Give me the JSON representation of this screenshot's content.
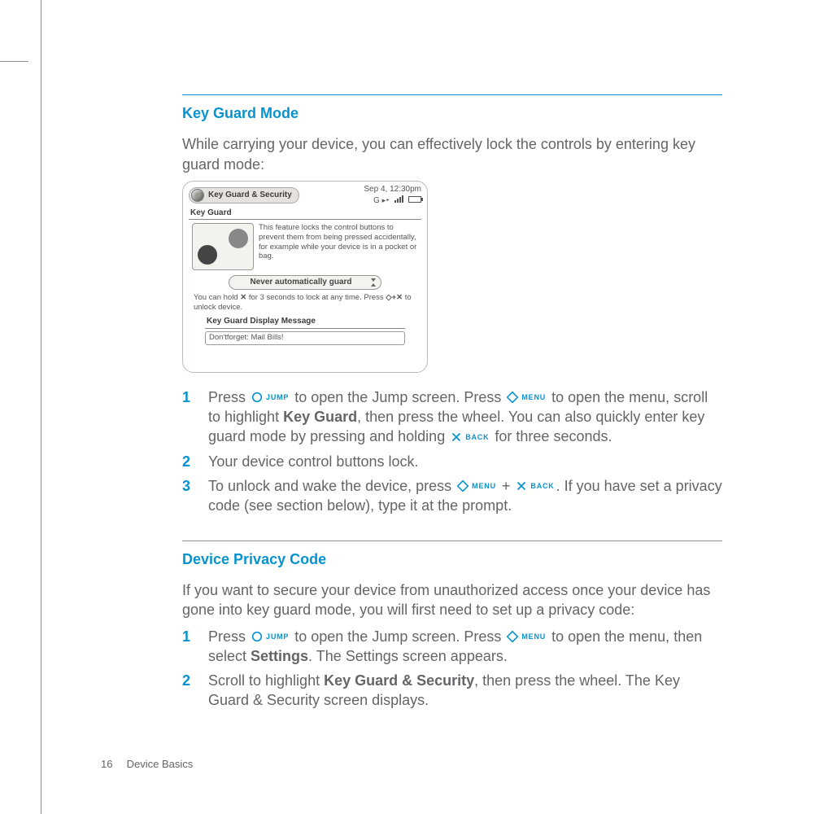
{
  "section1": {
    "heading": "Key Guard Mode",
    "intro": "While carrying your device, you can effectively lock the controls by entering key guard mode:",
    "steps": [
      {
        "num": "1",
        "parts": {
          "a": "Press ",
          "b": " to open the Jump screen. Press ",
          "c": " to open the menu, scroll to highlight ",
          "d": "Key Guard",
          "e": ", then press the wheel. You can also quickly enter key guard mode by pressing and holding ",
          "f": " for three seconds."
        }
      },
      {
        "num": "2",
        "text": "Your device control buttons lock."
      },
      {
        "num": "3",
        "parts": {
          "a": "To unlock and wake the device, press ",
          "b": " + ",
          "c": ". If you have set a privacy code (see section below), type it at the prompt."
        }
      }
    ]
  },
  "section2": {
    "heading": "Device Privacy Code",
    "intro": "If you want to secure your device from unauthorized access once your device has gone into key guard mode, you will first need to set up a privacy code:",
    "steps": [
      {
        "num": "1",
        "parts": {
          "a": "Press ",
          "b": " to open the Jump screen. Press ",
          "c": " to open the menu, then select ",
          "d": "Settings",
          "e": ". The Settings screen appears."
        }
      },
      {
        "num": "2",
        "parts": {
          "a": "Scroll to highlight ",
          "b": "Key Guard & Security",
          "c": ", then press the wheel. The Key Guard & Security screen displays."
        }
      }
    ]
  },
  "buttons": {
    "jump": "JUMP",
    "menu": "MENU",
    "back": "BACK"
  },
  "screenshot": {
    "title": "Key Guard & Security",
    "time": "Sep 4, 12:30pm",
    "carrier": "G",
    "sect1": "Key Guard",
    "desc": "This feature locks the control buttons to prevent them from being pressed accidentally, for example while your device is in a pocket or bag.",
    "dropdown": "Never automatically guard",
    "note1": "You can hold ",
    "note2": " for 3 seconds to lock at any time.  Press ",
    "note3": " to unlock device.",
    "noteX1": "✕",
    "noteX2": "◇+✕",
    "sect2": "Key Guard Display Message",
    "input": "Don'tforget: Mail Bills!"
  },
  "footer": {
    "page": "16",
    "chapter": "Device Basics"
  }
}
